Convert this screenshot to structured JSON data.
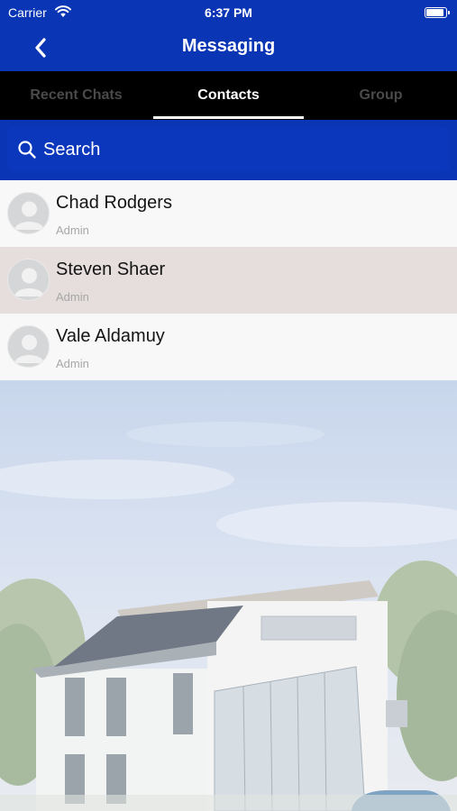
{
  "status_bar": {
    "carrier": "Carrier",
    "time": "6:37 PM"
  },
  "header": {
    "title": "Messaging"
  },
  "tabs": [
    {
      "label": "Recent Chats",
      "active": false
    },
    {
      "label": "Contacts",
      "active": true
    },
    {
      "label": "Group",
      "active": false
    }
  ],
  "search": {
    "placeholder": "Search"
  },
  "contacts": [
    {
      "name": "Chad Rodgers",
      "role": "Admin",
      "selected": false
    },
    {
      "name": "Steven Shaer",
      "role": "Admin",
      "selected": true
    },
    {
      "name": "Vale Aldamuy",
      "role": "Admin",
      "selected": false
    }
  ],
  "colors": {
    "brand_blue": "#0a35b4",
    "tab_bar": "#000000",
    "selected_row": "#e5dedd"
  },
  "icons": [
    "wifi-icon",
    "battery-icon",
    "back-chevron-icon",
    "search-icon",
    "avatar-placeholder-icon"
  ]
}
